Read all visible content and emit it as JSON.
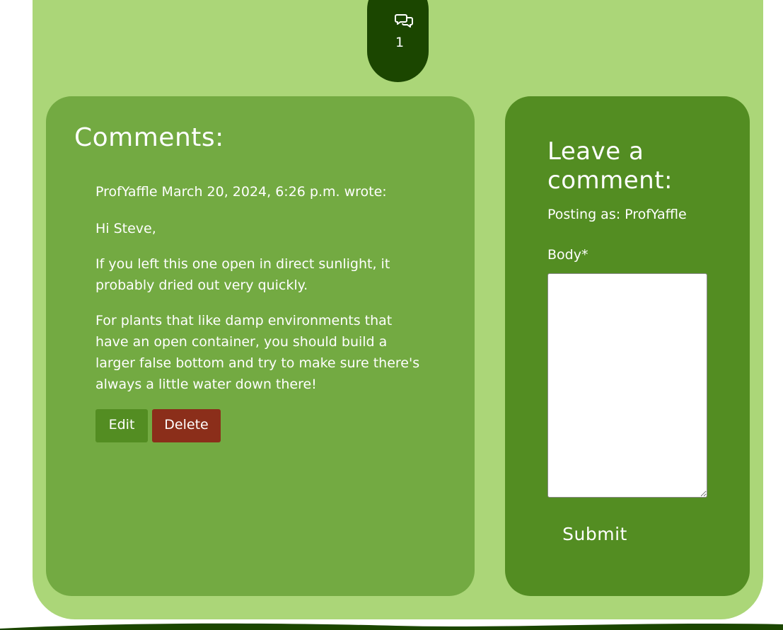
{
  "comment_count": {
    "icon": "comments-icon",
    "value": "1"
  },
  "comments": {
    "title": "Comments:",
    "items": [
      {
        "meta": "ProfYaffle March 20, 2024, 6:26 p.m. wrote:",
        "paragraphs": [
          "Hi Steve,",
          "If you left this one open in direct sunlight, it probably dried out very quickly.",
          "For plants that like damp environments that have an open container, you should build a larger false bottom and try to make sure there's always a little water down there!"
        ],
        "edit_label": "Edit",
        "delete_label": "Delete"
      }
    ]
  },
  "form": {
    "title": "Leave a comment:",
    "posting_as": "Posting as: ProfYaffle",
    "body_label": "Body*",
    "body_value": "",
    "submit_label": "Submit"
  },
  "colors": {
    "page_background": "#ffffff",
    "outer_panel": "#abd678",
    "comments_panel": "#73aa42",
    "form_panel": "#538d22",
    "dark_green": "#1b4600",
    "edit_button": "#538d22",
    "delete_button": "#8b2e1a"
  }
}
